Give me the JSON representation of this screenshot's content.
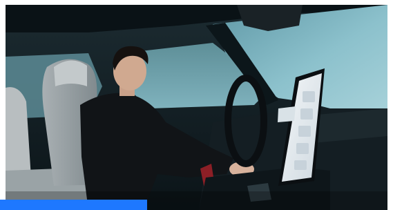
{
  "photo": {
    "subject": "photo-of-driver-in-car-interior",
    "icon": "photo-icon"
  },
  "accent_bar": {
    "color": "#1e78ff"
  },
  "colors": {
    "window_cyan": "#7fb6c2",
    "cabin_dark": "#0f1c22",
    "screen_white": "#e9eef2"
  }
}
